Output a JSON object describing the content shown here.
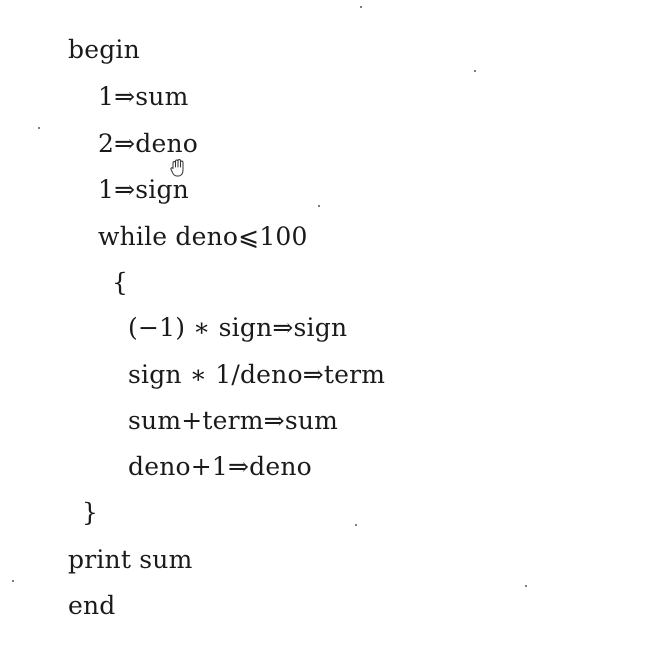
{
  "document": {
    "lines": {
      "begin": "begin",
      "init_sum": "1⇒sum",
      "init_deno": "2⇒deno",
      "init_sign": "1⇒sign",
      "while": "while deno⩽100",
      "open_brace": "{",
      "body_sign": "(−1) ∗ sign⇒sign",
      "body_term": "sign ∗ 1/deno⇒term",
      "body_sum": "sum+term⇒sum",
      "body_deno": "deno+1⇒deno",
      "close_brace": "}",
      "print": "print sum",
      "end": "end"
    }
  },
  "cursor": {
    "icon": "hand-cursor-icon"
  }
}
